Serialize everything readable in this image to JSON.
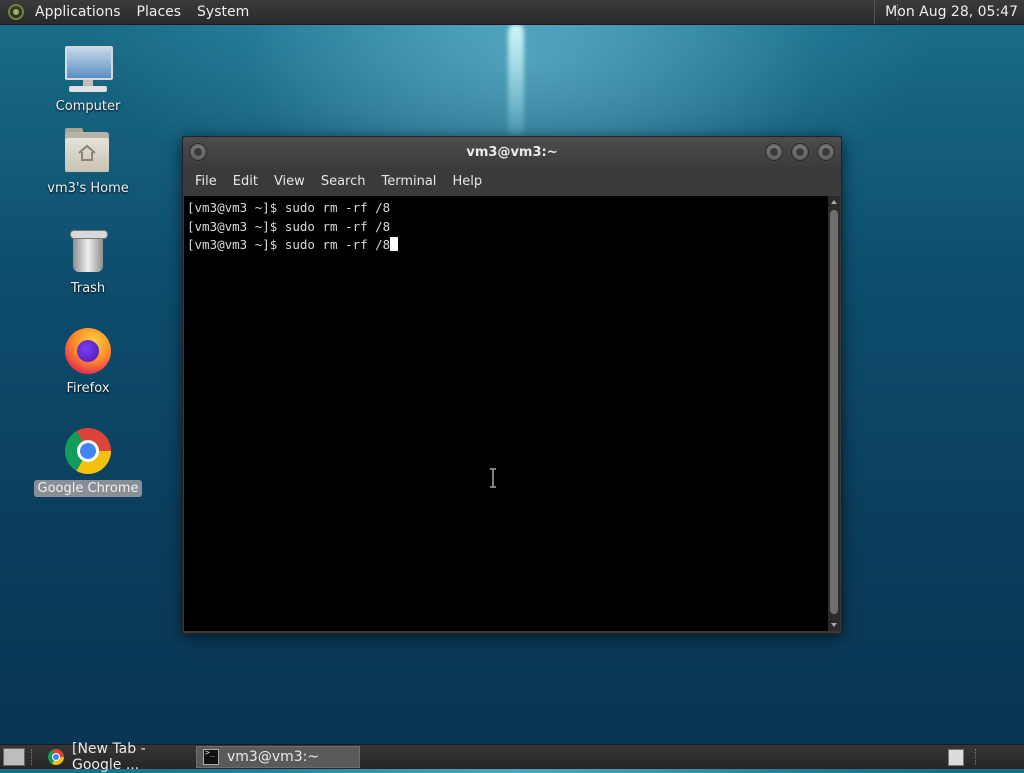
{
  "top_panel": {
    "menus": [
      "Applications",
      "Places",
      "System"
    ],
    "clock": "Mon Aug 28, 05:47"
  },
  "desktop_icons": [
    {
      "label": "Computer",
      "icon": "computer-icon"
    },
    {
      "label": "vm3's Home",
      "icon": "home-folder-icon"
    },
    {
      "label": "Trash",
      "icon": "trash-icon"
    },
    {
      "label": "Firefox",
      "icon": "firefox-icon"
    },
    {
      "label": "Google Chrome",
      "icon": "chrome-icon",
      "selected": true
    }
  ],
  "terminal": {
    "title": "vm3@vm3:~",
    "menus": [
      "File",
      "Edit",
      "View",
      "Search",
      "Terminal",
      "Help"
    ],
    "lines": [
      "[vm3@vm3 ~]$ sudo rm -rf /8",
      "[vm3@vm3 ~]$ sudo rm -rf /8",
      "[vm3@vm3 ~]$ sudo rm -rf /8"
    ]
  },
  "taskbar": {
    "tasks": [
      {
        "label": "[New Tab - Google ...",
        "icon": "chrome-icon",
        "active": false
      },
      {
        "label": "vm3@vm3:~",
        "icon": "terminal-icon",
        "active": true
      }
    ]
  }
}
